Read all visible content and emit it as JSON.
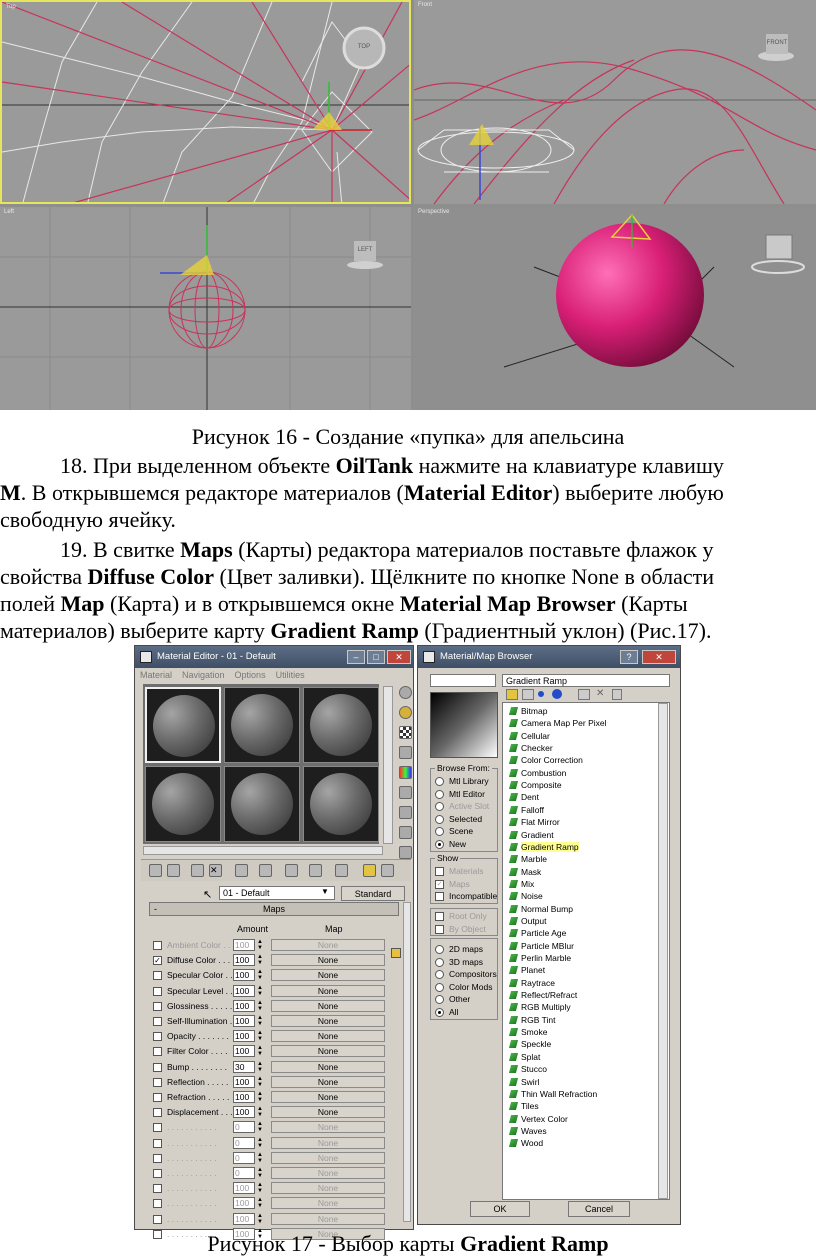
{
  "viewports": {
    "top": {
      "label": "Top",
      "cube": "TOP"
    },
    "front": {
      "label": "Front",
      "cube": "FRONT"
    },
    "left": {
      "label": "Left",
      "cube": "LEFT"
    },
    "perspective": {
      "label": "Perspective"
    }
  },
  "caption16": "Рисунок 16 - Создание «пупка» для апельсина",
  "step18": {
    "line1": {
      "a": "18. При выделенном объекте ",
      "b": "OilTank",
      "c": " нажмите на клавиатуре клавишу"
    },
    "line2": {
      "a": "M",
      "b": ". В открывшемся редакторе материалов (",
      "c": "Material Editor",
      "d": ") выберите любую"
    },
    "line3": "свободную ячейку."
  },
  "step19": {
    "line1": {
      "a": "19. В свитке ",
      "b": "Maps",
      "c": " (Карты) редактора материалов поставьте флажок у"
    },
    "line2": {
      "a": "свойства ",
      "b": "Diffuse Color",
      "c": " (Цвет заливки). Щёлкните по кнопке None в области"
    },
    "line3": {
      "a": "полей ",
      "b": "Map",
      "c": " (Карта) и в открывшемся окне ",
      "d": "Material Map Browser",
      "e": " (Карты"
    },
    "line4": {
      "a": "материалов) выберите карту ",
      "b": "Gradient Ramp",
      "c": " (Градиентный уклон) (Рис.17)."
    }
  },
  "material_editor": {
    "title": "Material Editor - 01 - Default",
    "menu": [
      "Material",
      "Navigation",
      "Options",
      "Utilities"
    ],
    "material_name": "01 - Default",
    "type_button": "Standard",
    "maps_rollout": "Maps",
    "minus": "-",
    "col_amount": "Amount",
    "col_map": "Map",
    "rows": [
      {
        "label": "Ambient Color . .",
        "amount": "100",
        "map": "None",
        "checked": false,
        "dim": true
      },
      {
        "label": "Diffuse Color . . .",
        "amount": "100",
        "map": "None",
        "checked": true,
        "dim": false
      },
      {
        "label": "Specular Color . .",
        "amount": "100",
        "map": "None",
        "checked": false,
        "dim": false
      },
      {
        "label": "Specular Level . .",
        "amount": "100",
        "map": "None",
        "checked": false,
        "dim": false
      },
      {
        "label": "Glossiness . . . . .",
        "amount": "100",
        "map": "None",
        "checked": false,
        "dim": false
      },
      {
        "label": "Self-Illumination .",
        "amount": "100",
        "map": "None",
        "checked": false,
        "dim": false
      },
      {
        "label": "Opacity . . . . . . .",
        "amount": "100",
        "map": "None",
        "checked": false,
        "dim": false
      },
      {
        "label": "Filter Color . . . .",
        "amount": "100",
        "map": "None",
        "checked": false,
        "dim": false
      },
      {
        "label": "Bump . . . . . . . .",
        "amount": "30",
        "map": "None",
        "checked": false,
        "dim": false
      },
      {
        "label": "Reflection . . . . .",
        "amount": "100",
        "map": "None",
        "checked": false,
        "dim": false
      },
      {
        "label": "Refraction . . . . .",
        "amount": "100",
        "map": "None",
        "checked": false,
        "dim": false
      },
      {
        "label": "Displacement . . .",
        "amount": "100",
        "map": "None",
        "checked": false,
        "dim": false
      },
      {
        "label": ". . . . . . . . . . .",
        "amount": "0",
        "map": "None",
        "checked": false,
        "dim": true
      },
      {
        "label": ". . . . . . . . . . .",
        "amount": "0",
        "map": "None",
        "checked": false,
        "dim": true
      },
      {
        "label": ". . . . . . . . . . .",
        "amount": "0",
        "map": "None",
        "checked": false,
        "dim": true
      },
      {
        "label": ". . . . . . . . . . .",
        "amount": "0",
        "map": "None",
        "checked": false,
        "dim": true
      },
      {
        "label": ". . . . . . . . . . .",
        "amount": "100",
        "map": "None",
        "checked": false,
        "dim": true
      },
      {
        "label": ". . . . . . . . . . .",
        "amount": "100",
        "map": "None",
        "checked": false,
        "dim": true
      },
      {
        "label": ". . . . . . . . . . .",
        "amount": "100",
        "map": "None",
        "checked": false,
        "dim": true
      },
      {
        "label": ". . . . . . . . . . .",
        "amount": "100",
        "map": "None",
        "checked": false,
        "dim": true
      }
    ]
  },
  "map_browser": {
    "title": "Material/Map Browser",
    "name_field": "Gradient Ramp",
    "browse_from": {
      "title": "Browse From:",
      "options": [
        {
          "label": "Mtl Library",
          "on": false,
          "dim": false
        },
        {
          "label": "Mtl Editor",
          "on": false,
          "dim": false
        },
        {
          "label": "Active Slot",
          "on": false,
          "dim": true
        },
        {
          "label": "Selected",
          "on": false,
          "dim": false
        },
        {
          "label": "Scene",
          "on": false,
          "dim": false
        },
        {
          "label": "New",
          "on": true,
          "dim": false
        }
      ]
    },
    "show": {
      "title": "Show",
      "options": [
        {
          "label": "Materials",
          "checked": false,
          "dim": true
        },
        {
          "label": "Maps",
          "checked": true,
          "dim": true
        },
        {
          "label": "Incompatible",
          "checked": false,
          "dim": false
        }
      ]
    },
    "root": {
      "options": [
        {
          "label": "Root Only",
          "checked": false,
          "dim": true
        },
        {
          "label": "By Object",
          "checked": false,
          "dim": true
        }
      ]
    },
    "categories": [
      {
        "label": "2D maps",
        "on": false
      },
      {
        "label": "3D maps",
        "on": false
      },
      {
        "label": "Compositors",
        "on": false
      },
      {
        "label": "Color Mods",
        "on": false
      },
      {
        "label": "Other",
        "on": false
      },
      {
        "label": "All",
        "on": true
      }
    ],
    "items": [
      "Bitmap",
      "Camera Map Per Pixel",
      "Cellular",
      "Checker",
      "Color Correction",
      "Combustion",
      "Composite",
      "Dent",
      "Falloff",
      "Flat Mirror",
      "Gradient",
      "Gradient Ramp",
      "Marble",
      "Mask",
      "Mix",
      "Noise",
      "Normal Bump",
      "Output",
      "Particle Age",
      "Particle MBlur",
      "Perlin Marble",
      "Planet",
      "Raytrace",
      "Reflect/Refract",
      "RGB Multiply",
      "RGB Tint",
      "Smoke",
      "Speckle",
      "Splat",
      "Stucco",
      "Swirl",
      "Thin Wall Refraction",
      "Tiles",
      "Vertex Color",
      "Waves",
      "Wood"
    ],
    "selected_item": "Gradient Ramp",
    "ok": "OK",
    "cancel": "Cancel"
  },
  "caption17": {
    "a": "Рисунок 17 - Выбор карты ",
    "b": "Gradient Ramp"
  }
}
